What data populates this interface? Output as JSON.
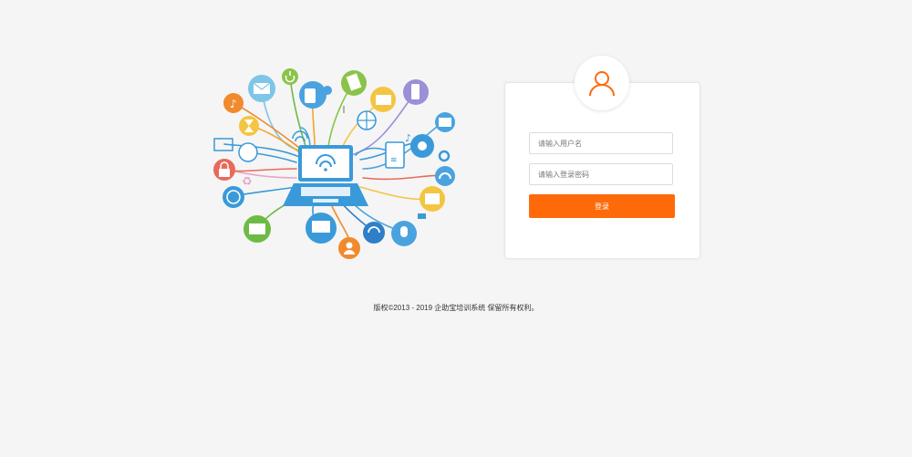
{
  "login": {
    "username_placeholder": "请输入用户名",
    "password_placeholder": "请输入登录密码",
    "submit_label": "登录"
  },
  "footer": {
    "copyright": "版权©2013 - 2019 企助宝培训系统 保留所有权利。"
  },
  "icons": {
    "avatar": "user-icon",
    "illustration": "network-devices-illustration"
  },
  "colors": {
    "background": "#f5f5f5",
    "accent": "#fe6a0a",
    "card": "#ffffff",
    "laptop": "#3a9ad9"
  }
}
